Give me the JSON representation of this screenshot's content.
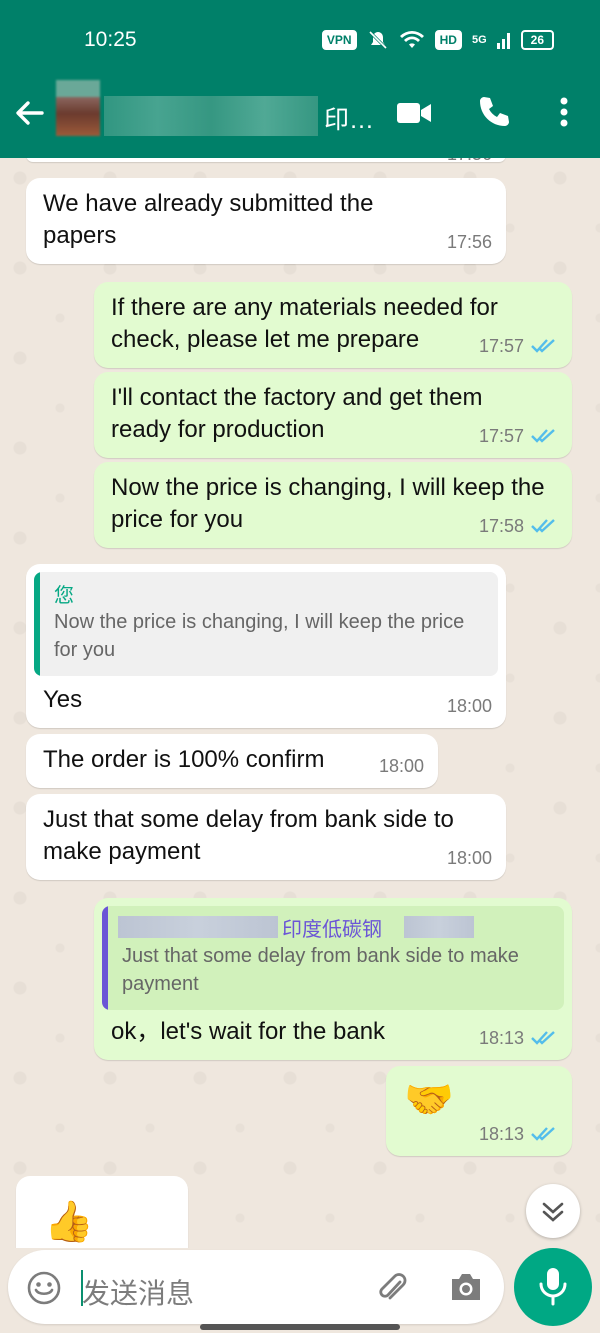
{
  "status_bar": {
    "time": "10:25",
    "vpn": "VPN",
    "hd": "HD",
    "network": "5G",
    "battery": "26"
  },
  "header": {
    "contact_name_visible": "印…",
    "icons": [
      "back-arrow-icon",
      "video-call-icon",
      "voice-call-icon",
      "more-options-icon"
    ]
  },
  "messages": [
    {
      "dir": "in",
      "text": "We have already submitted the papers",
      "time": "17:56"
    },
    {
      "dir": "out",
      "text": "If there are any materials needed for check, please let me prepare",
      "time": "17:57",
      "status": "read"
    },
    {
      "dir": "out",
      "text": "I'll contact the factory and get them ready for production",
      "time": "17:57",
      "status": "read"
    },
    {
      "dir": "out",
      "text": "Now the price is changing, I will keep the  price for you",
      "time": "17:58",
      "status": "read"
    },
    {
      "dir": "in",
      "quote_author": "您",
      "quote_text": "Now the price is changing, I will keep the price for you",
      "text": "Yes",
      "time": "18:00"
    },
    {
      "dir": "in",
      "text": "The order is 100% confirm",
      "time": "18:00"
    },
    {
      "dir": "in",
      "text": "Just that some delay from bank side to make payment",
      "time": "18:00"
    },
    {
      "dir": "out",
      "quote_author": "印度低碳钢",
      "quote_text": "Just that some delay from bank side to make payment",
      "text": "ok，let's wait for the bank",
      "time": "18:13",
      "status": "read"
    },
    {
      "dir": "out",
      "text": "🤝",
      "time": "18:13",
      "status": "read"
    },
    {
      "dir": "in",
      "text": "👍"
    }
  ],
  "input": {
    "placeholder": "发送消息"
  },
  "colors": {
    "header": "#008069",
    "outgoing_bubble": "#e2fbd0",
    "incoming_bubble": "#ffffff",
    "read_ticks": "#53bdeb",
    "mic_button": "#00a884"
  }
}
